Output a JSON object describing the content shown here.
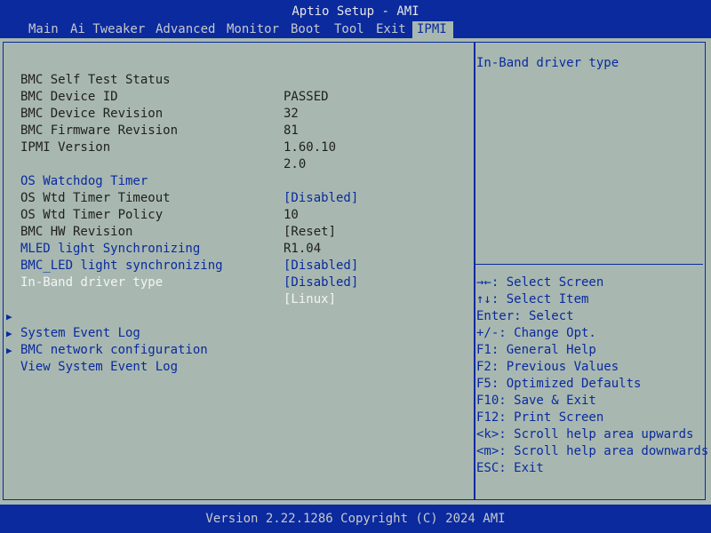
{
  "title": "Aptio Setup - AMI",
  "tabs": [
    "Main",
    "Ai Tweaker",
    "Advanced",
    "Monitor",
    "Boot",
    "Tool",
    "Exit",
    "IPMI"
  ],
  "active_tab": "IPMI",
  "info": [
    {
      "label": "BMC Self Test Status",
      "value": "PASSED"
    },
    {
      "label": "BMC Device ID",
      "value": "32"
    },
    {
      "label": "BMC Device Revision",
      "value": "81"
    },
    {
      "label": "BMC Firmware Revision",
      "value": "1.60.10"
    },
    {
      "label": "IPMI Version",
      "value": "2.0"
    }
  ],
  "settings": [
    {
      "label": "OS Watchdog Timer",
      "value": "[Disabled]"
    },
    {
      "label": "OS Wtd Timer Timeout",
      "value": "10"
    },
    {
      "label": "OS Wtd Timer Policy",
      "value": "[Reset]"
    },
    {
      "label": "BMC HW Revision",
      "value": "R1.04"
    },
    {
      "label": "MLED light Synchronizing",
      "value": "[Disabled]"
    },
    {
      "label": "BMC_LED light synchronizing",
      "value": "[Disabled]"
    },
    {
      "label": "In-Band driver type",
      "value": "[Linux]"
    }
  ],
  "submenus": [
    "System Event Log",
    "BMC network configuration",
    "View System Event Log"
  ],
  "help": {
    "text": "In-Band driver type"
  },
  "keys": [
    "→←: Select Screen",
    "↑↓: Select Item",
    "Enter: Select",
    "+/-: Change Opt.",
    "F1: General Help",
    "F2: Previous Values",
    "F5: Optimized Defaults",
    "F10: Save & Exit",
    "F12: Print Screen",
    "<k>: Scroll help area upwards",
    "<m>: Scroll help area downwards",
    "ESC: Exit"
  ],
  "footer": "Version 2.22.1286 Copyright (C) 2024 AMI",
  "colors": {
    "background": "#a8b8b0",
    "accent": "#0a2a9e",
    "selected_text": "#f4f4f4"
  }
}
